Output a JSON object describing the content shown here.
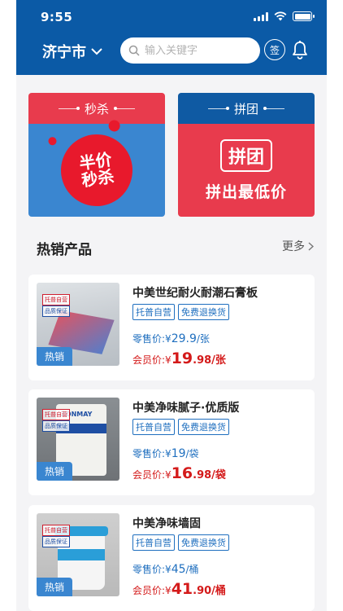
{
  "status": {
    "time": "9:55"
  },
  "header": {
    "city": "济宁市",
    "search_placeholder": "输入关键字",
    "sign_label": "签"
  },
  "promos": {
    "flash": {
      "title": "秒杀",
      "line1": "半价",
      "line2": "秒杀"
    },
    "group": {
      "title": "拼团",
      "logo": "拼团",
      "slogan": "拼出最低价"
    }
  },
  "section": {
    "title": "热销产品",
    "more": "更多"
  },
  "products": [
    {
      "name": "中美世纪耐火耐潮石膏板",
      "badges": [
        "托普自营",
        "免费退换货"
      ],
      "retail_label": "零售价:",
      "retail_currency": "¥",
      "retail_price": "29.9",
      "retail_unit": "/张",
      "member_label": "会员价:",
      "member_currency": "¥",
      "member_int": "19",
      "member_dec": ".98",
      "member_unit": "/张",
      "hot_label": "热销",
      "img_tags": [
        "托普自营",
        "品质保证"
      ]
    },
    {
      "name": "中美净味腻子·优质版",
      "badges": [
        "托普自营",
        "免费退换货"
      ],
      "retail_label": "零售价:",
      "retail_currency": "¥",
      "retail_price": "19",
      "retail_unit": "/袋",
      "member_label": "会员价:",
      "member_currency": "¥",
      "member_int": "16",
      "member_dec": ".98",
      "member_unit": "/袋",
      "hot_label": "热销",
      "img_tags": [
        "托普自营",
        "品质保证"
      ],
      "img_brand": "ZONMAY"
    },
    {
      "name": "中美净味墙固",
      "badges": [
        "托普自营",
        "免费退换货"
      ],
      "retail_label": "零售价:",
      "retail_currency": "¥",
      "retail_price": "45",
      "retail_unit": "/桶",
      "member_label": "会员价:",
      "member_currency": "¥",
      "member_int": "41",
      "member_dec": ".90",
      "member_unit": "/桶",
      "hot_label": "热销",
      "img_tags": [
        "托普自营",
        "品质保证"
      ]
    }
  ],
  "colors": {
    "header": "#0b5aa6",
    "accent_red": "#e83b4d",
    "accent_blue": "#3a86d0",
    "price_red": "#d41a1a"
  },
  "icons": [
    "chevron-down-icon",
    "search-icon",
    "bell-icon",
    "chevron-right-icon",
    "signal-icon",
    "wifi-icon",
    "battery-icon"
  ]
}
